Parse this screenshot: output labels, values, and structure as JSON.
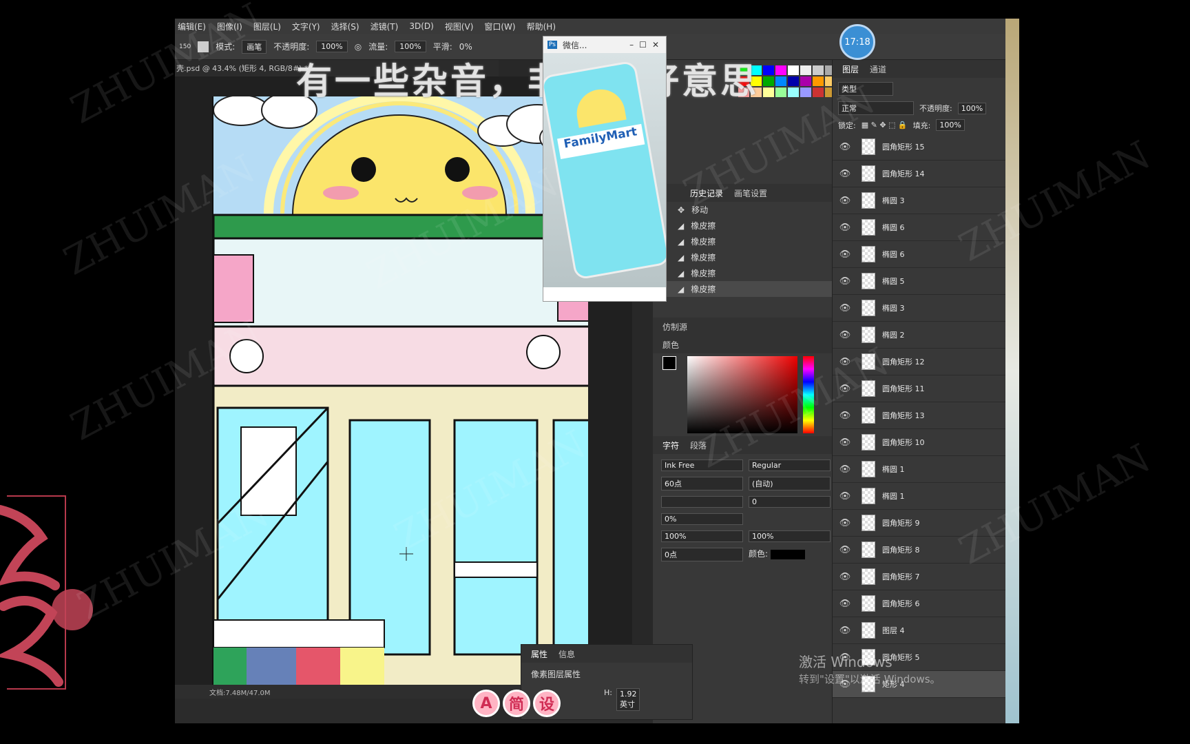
{
  "menu": [
    "编辑(E)",
    "图像(I)",
    "图层(L)",
    "文字(Y)",
    "选择(S)",
    "滤镜(T)",
    "3D(D)",
    "视图(V)",
    "窗口(W)",
    "帮助(H)"
  ],
  "options": {
    "brush_size": "150",
    "mode_label": "模式:",
    "mode_value": "画笔",
    "opacity_label": "不透明度:",
    "opacity_value": "100%",
    "flow_label": "流量:",
    "flow_value": "100%",
    "smooth_label": "平滑:",
    "smooth_value": "0%"
  },
  "doc_tab": "壳.psd @ 43.4% (矩形 4, RGB/8#) *",
  "overlay_text": "有一些杂音，非常不好意思",
  "clock": "17:18",
  "wechat": {
    "title": "微信...",
    "brand": "FamilyMart"
  },
  "history": {
    "tab_history": "历史记录",
    "tab_brush": "画笔设置",
    "items": [
      {
        "icon": "move-icon",
        "label": "移动"
      },
      {
        "icon": "eraser-icon",
        "label": "橡皮擦"
      },
      {
        "icon": "eraser-icon",
        "label": "橡皮擦"
      },
      {
        "icon": "eraser-icon",
        "label": "橡皮擦"
      },
      {
        "icon": "eraser-icon",
        "label": "橡皮擦"
      },
      {
        "icon": "eraser-icon",
        "label": "橡皮擦"
      }
    ]
  },
  "clone_source": "仿制源",
  "color_panel": "颜色",
  "character": {
    "tab_char": "字符",
    "tab_para": "段落",
    "font": "Ink Free",
    "style": "Regular",
    "size": "60点",
    "leading": "(自动)",
    "tracking": "0",
    "scale_pct": "0%",
    "vscale": "100%",
    "hscale": "100%",
    "baseline": "0点",
    "color_label": "颜色:"
  },
  "layers": {
    "tab_layers": "图层",
    "tab_channels": "通道",
    "filter": "类型",
    "blend": "正常",
    "opacity_label": "不透明度:",
    "opacity": "100%",
    "lock_label": "锁定:",
    "fill_label": "填充:",
    "fill": "100%",
    "items": [
      "圆角矩形 15",
      "圆角矩形 14",
      "椭圆 3",
      "椭圆 6",
      "椭圆 6",
      "椭圆 5",
      "椭圆 3",
      "椭圆 2",
      "圆角矩形 12",
      "圆角矩形 11",
      "圆角矩形 13",
      "圆角矩形 10",
      "椭圆 1",
      "椭圆 1",
      "圆角矩形 9",
      "圆角矩形 8",
      "圆角矩形 7",
      "圆角矩形 6",
      "图层 4",
      "圆角矩形 5",
      "矩形 4"
    ]
  },
  "properties": {
    "tab_props": "属性",
    "tab_info": "信息",
    "title": "像素图层属性",
    "h_label": "H:",
    "h_value": "1.92 英寸"
  },
  "status": "文档:7.48M/47.0M",
  "activate_windows": {
    "line1": "激活 Windows",
    "line2": "转到\"设置\"以激活 Windows。"
  },
  "watermark": "ZHUIMAN",
  "stickers": [
    "A",
    "简",
    "设"
  ]
}
